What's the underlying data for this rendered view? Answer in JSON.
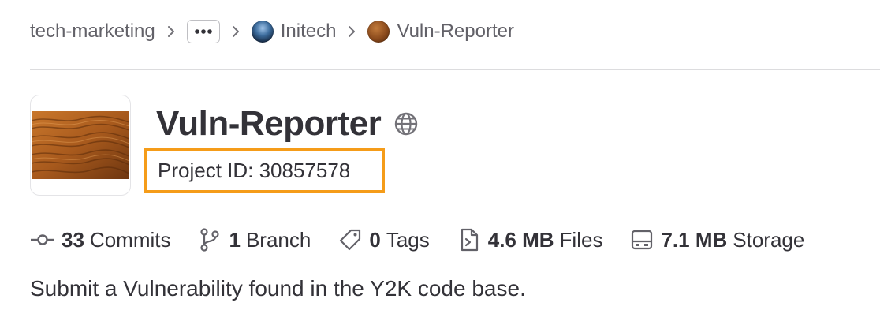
{
  "breadcrumb": {
    "group": "tech-marketing",
    "more_icon": "ellipsis-icon",
    "subgroup": "Initech",
    "project": "Vuln-Reporter"
  },
  "project": {
    "name": "Vuln-Reporter",
    "visibility_icon": "globe-icon",
    "id_label": "Project ID: 30857578",
    "description": "Submit a Vulnerability found in the Y2K code base."
  },
  "stats": [
    {
      "icon": "commit-icon",
      "count": "33",
      "label": "Commits"
    },
    {
      "icon": "branch-icon",
      "count": "1",
      "label": "Branch"
    },
    {
      "icon": "tag-icon",
      "count": "0",
      "label": "Tags"
    },
    {
      "icon": "file-icon",
      "count": "4.6 MB",
      "label": "Files"
    },
    {
      "icon": "storage-icon",
      "count": "7.1 MB",
      "label": "Storage"
    }
  ],
  "colors": {
    "highlight": "#f59c19",
    "text": "#333238",
    "muted": "#626168"
  }
}
